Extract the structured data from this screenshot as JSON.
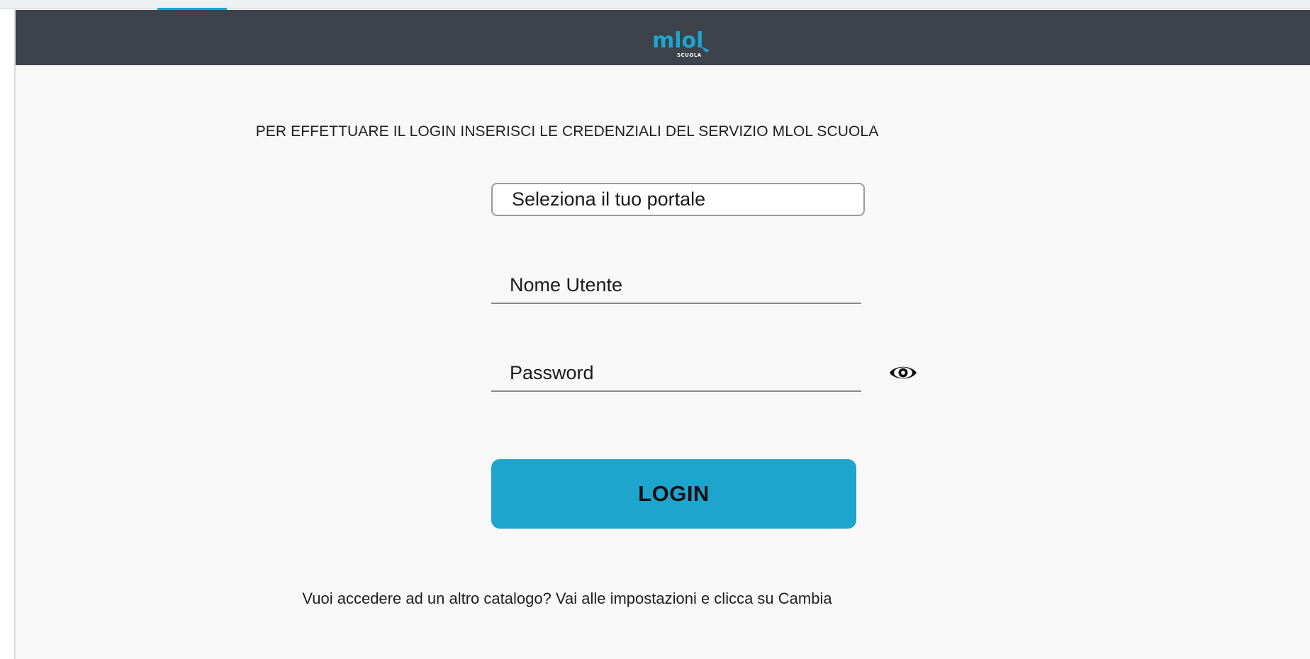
{
  "header": {
    "logo_text": "mlol",
    "logo_subtext": "SCUOLA"
  },
  "login": {
    "instruction": "PER EFFETTUARE IL LOGIN INSERISCI LE CREDENZIALI DEL SERVIZIO MLOL SCUOLA",
    "portal_select": "Seleziona il tuo portale",
    "username_placeholder": "Nome Utente",
    "password_placeholder": "Password",
    "login_button": "LOGIN",
    "footer_hint": "Vuoi accedere ad un altro catalogo? Vai alle impostazioni e clicca su Cambia"
  },
  "icons": {
    "password_toggle": "eye-icon"
  },
  "colors": {
    "header_bg": "#3d424b",
    "accent": "#1ea5cd",
    "page_bg": "#f8f8f8"
  }
}
